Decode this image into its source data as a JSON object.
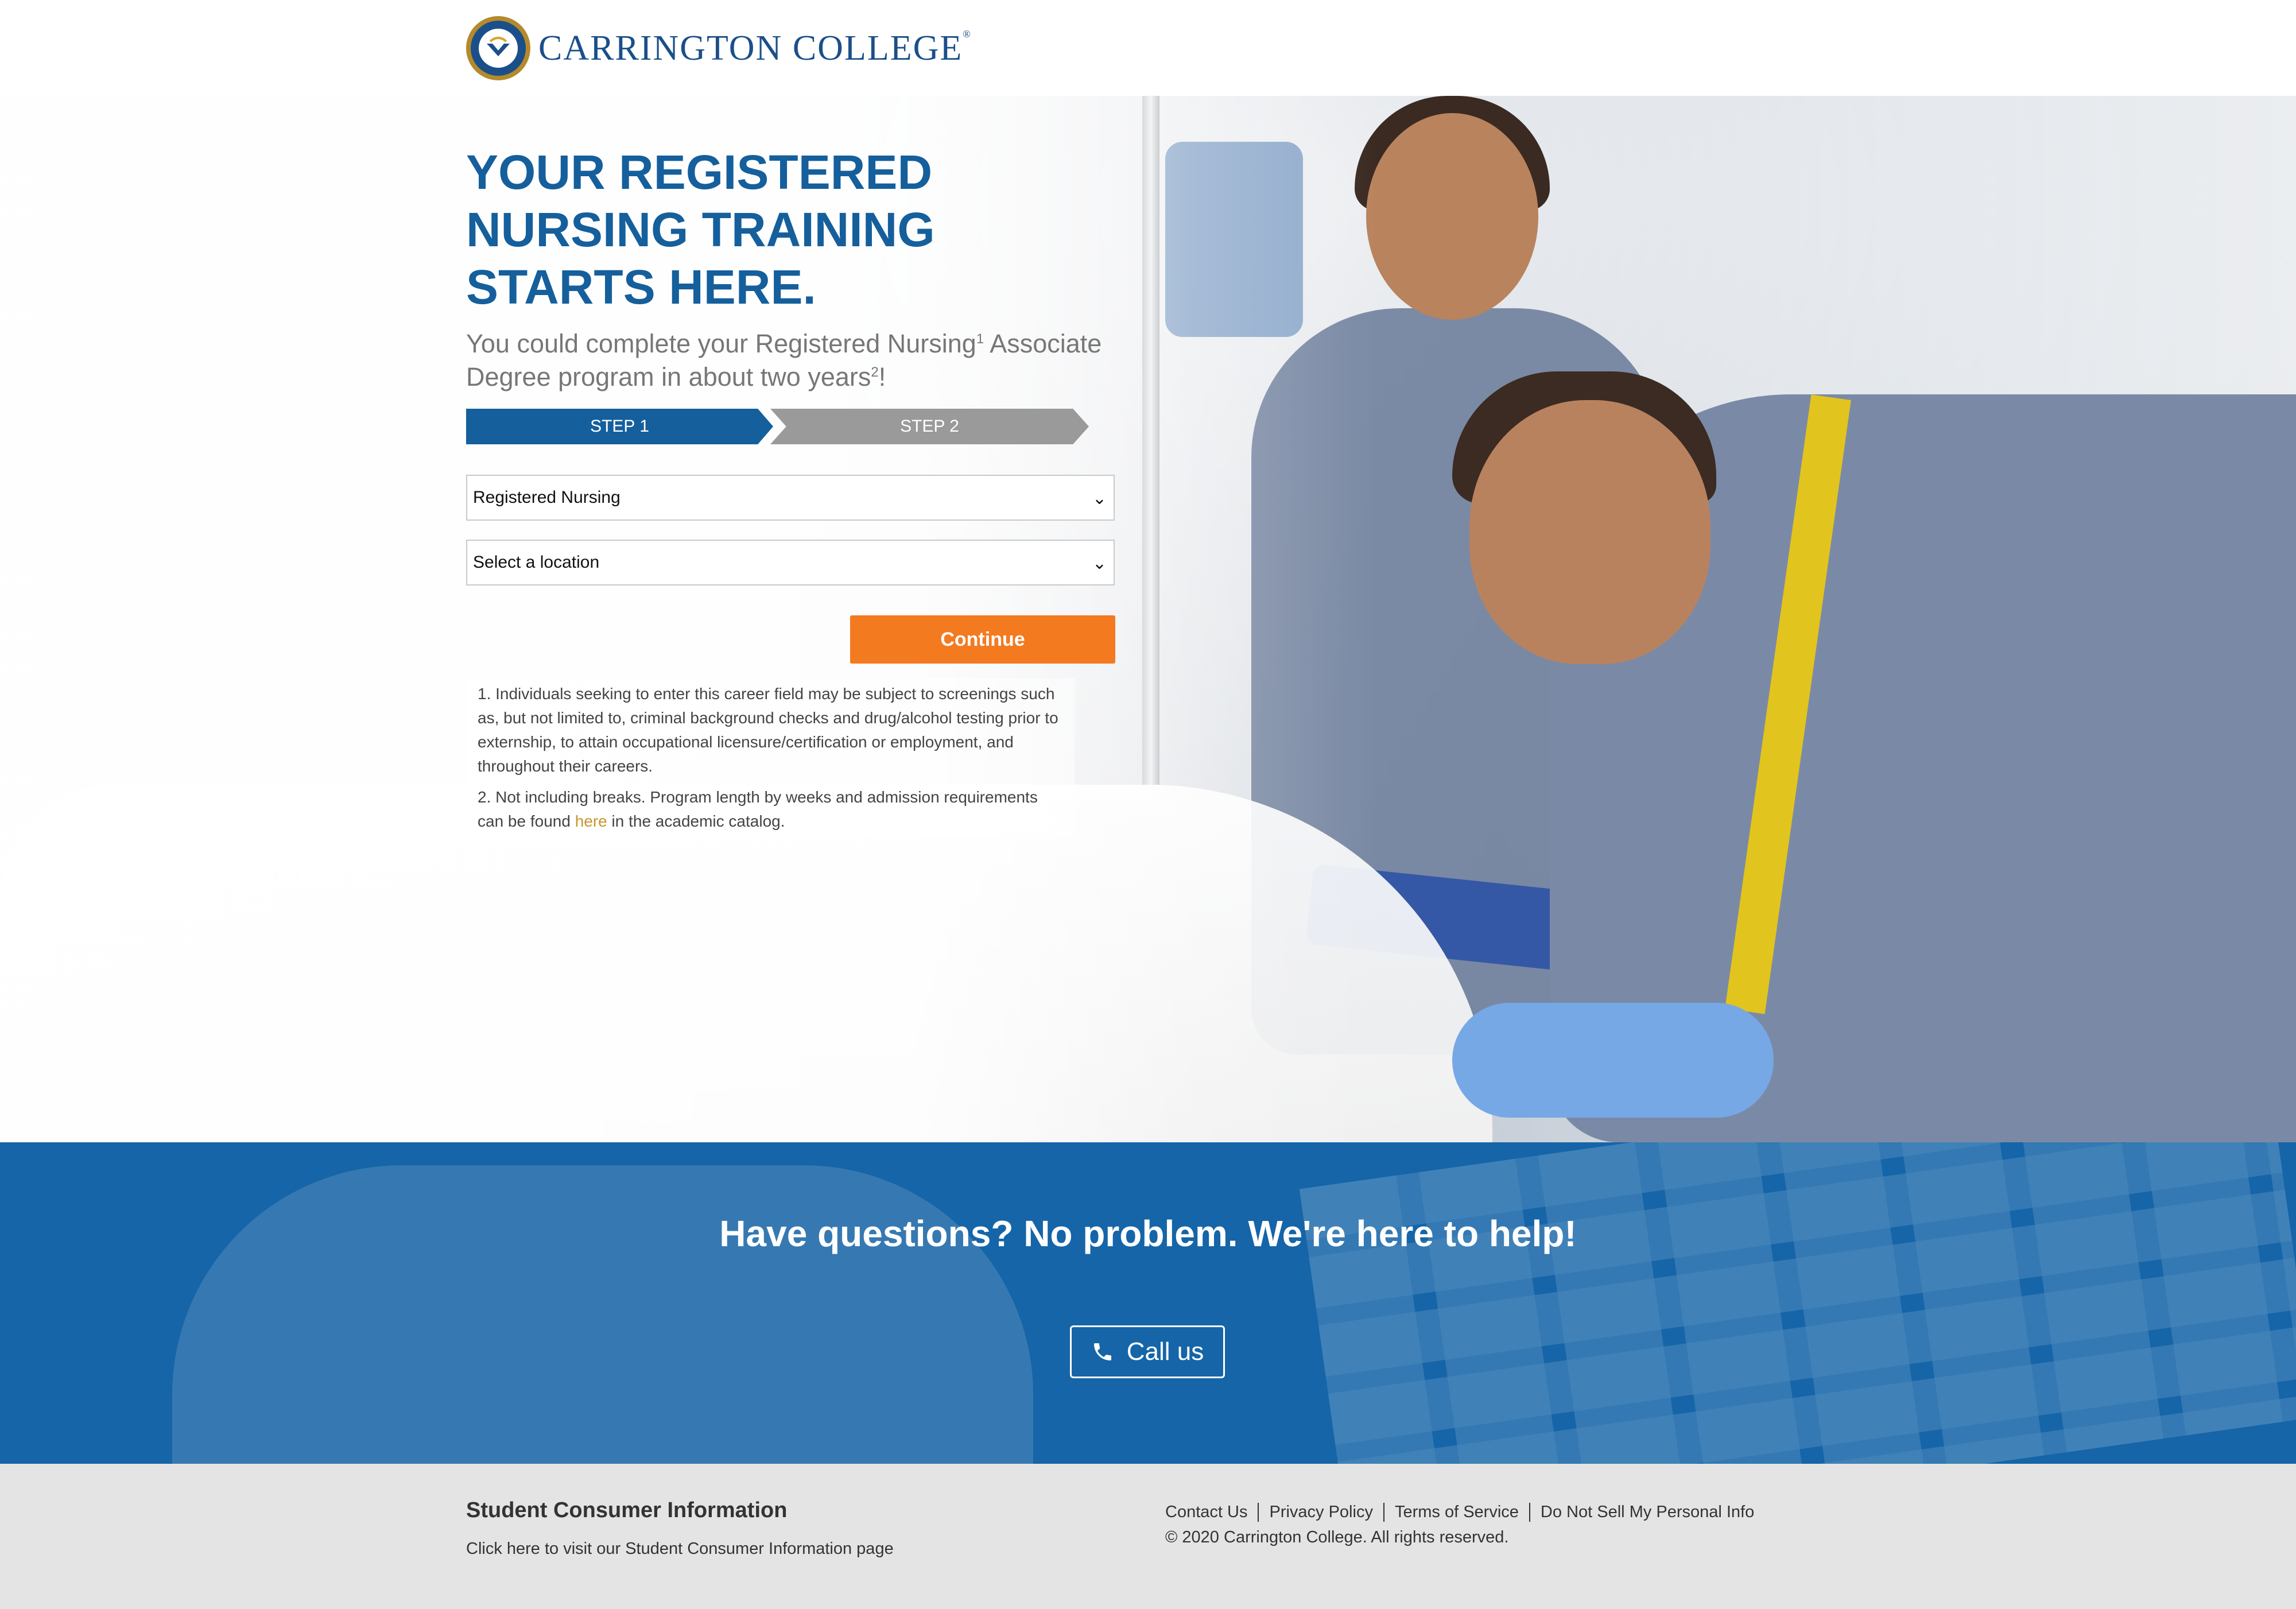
{
  "brand": {
    "logo_text": "CARRINGTON COLLEGE",
    "trademark": "®",
    "primary_color": "#155f9c",
    "accent_color": "#f47a20"
  },
  "hero": {
    "headline_line1": "YOUR REGISTERED",
    "headline_line2": "NURSING TRAINING",
    "headline_line3": "STARTS HERE.",
    "subhead_part1": "You could complete your Registered Nursing",
    "subhead_sup1": "1",
    "subhead_part2": " Associate Degree program in about two years",
    "subhead_sup2": "2",
    "subhead_part3": "!"
  },
  "steps": [
    {
      "label": "STEP 1",
      "active": true
    },
    {
      "label": "STEP 2",
      "active": false
    }
  ],
  "form": {
    "program_select": "Registered Nursing",
    "location_select": "Select a location",
    "continue_label": "Continue"
  },
  "notes": {
    "note1": "1. Individuals seeking to enter this career field may be subject to screenings such as, but not limited to, criminal background checks and drug/alcohol testing prior to externship, to attain occupational licensure/certification or employment, and throughout their careers.",
    "note2_before": "2. Not including breaks. Program length by weeks and admission requirements can be found ",
    "note2_link": "here",
    "note2_after": " in the academic catalog."
  },
  "help": {
    "title": "Have questions? No problem. We're here to help!",
    "call_label": "Call us",
    "call_icon": "phone-icon"
  },
  "footer": {
    "sci_title": "Student Consumer Information",
    "sci_link": "Click here to visit our Student Consumer Information page",
    "links": [
      "Contact Us",
      "Privacy Policy",
      "Terms of Service",
      "Do Not Sell My Personal Info"
    ],
    "copyright": "© 2020 Carrington College. All rights reserved."
  }
}
